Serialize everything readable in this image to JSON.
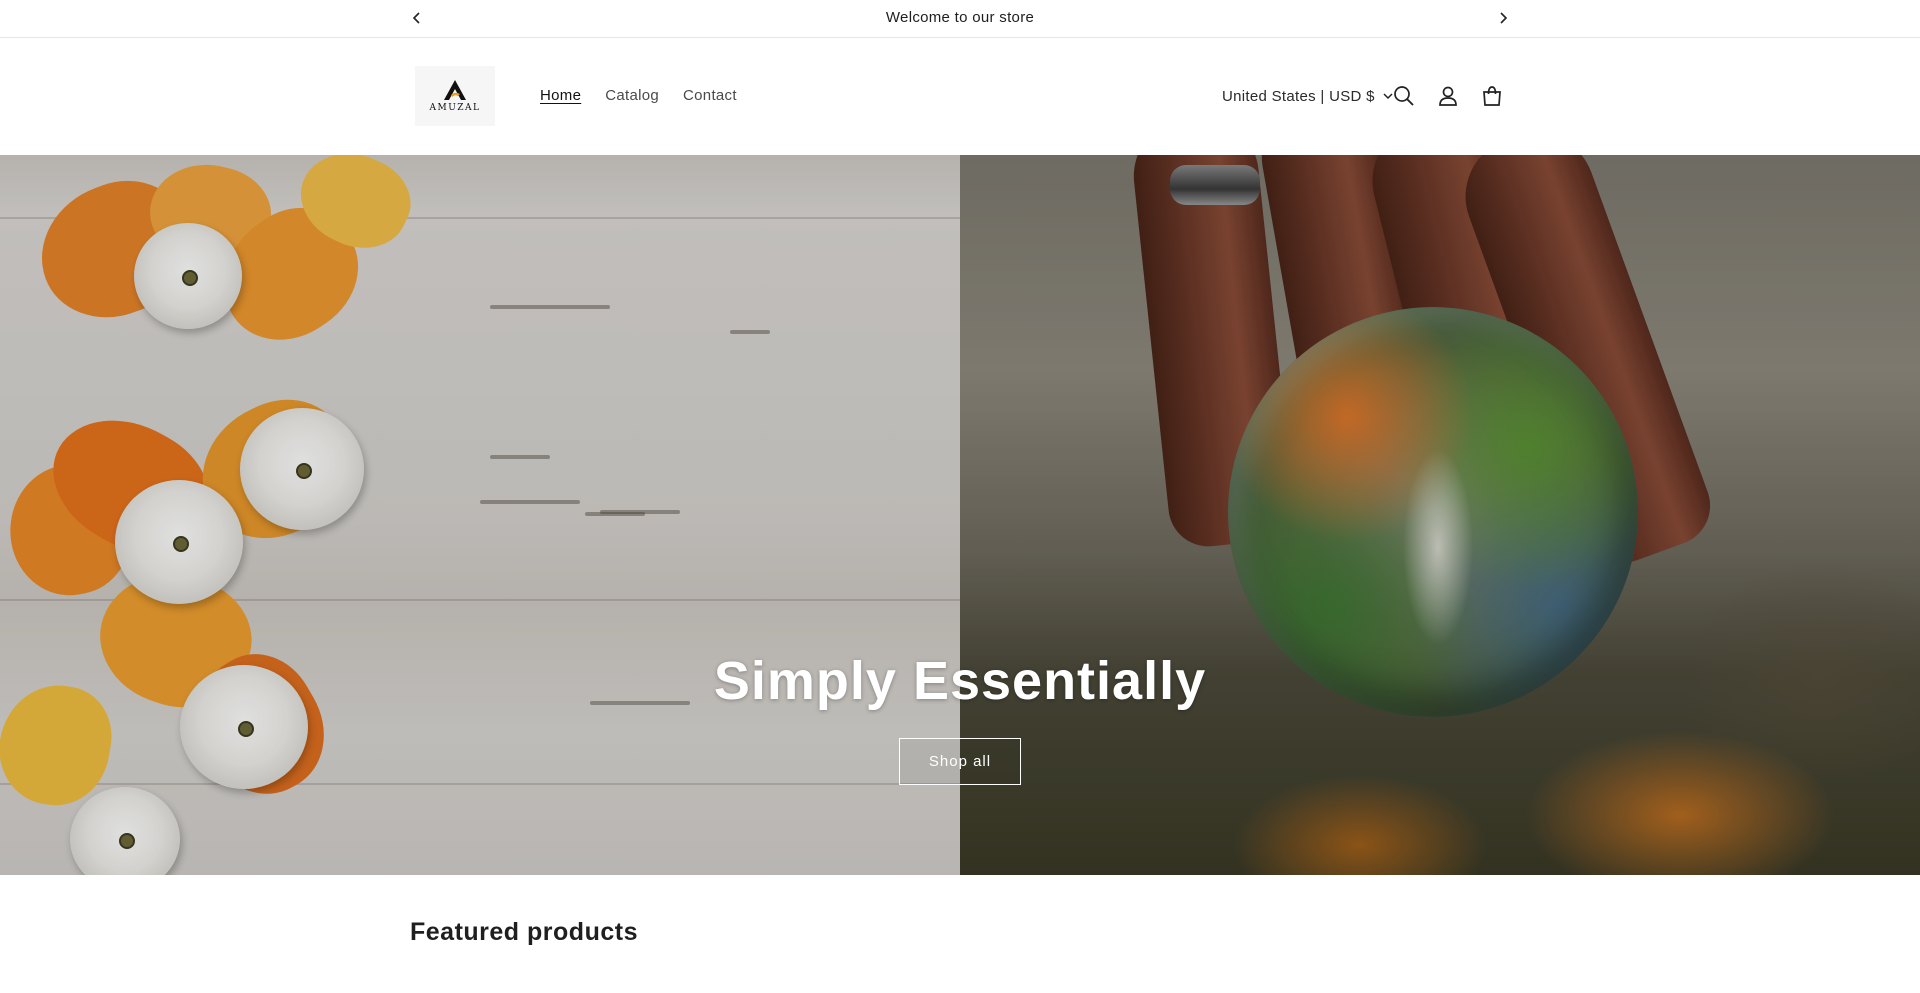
{
  "announcement": {
    "text": "Welcome to our store",
    "prev_icon": "chevron-left-icon",
    "next_icon": "chevron-right-icon"
  },
  "header": {
    "logo_text": "AMUZAL",
    "nav": [
      {
        "label": "Home",
        "active": true
      },
      {
        "label": "Catalog",
        "active": false
      },
      {
        "label": "Contact",
        "active": false
      }
    ],
    "country_selector": "United States | USD $",
    "icons": [
      "search-icon",
      "account-icon",
      "cart-icon"
    ]
  },
  "hero": {
    "title": "Simply Essentially",
    "button_label": "Shop all"
  },
  "featured": {
    "heading": "Featured products"
  },
  "colors": {
    "text": "#121212",
    "announce_border": "#e6e6e6",
    "hero_text": "#ffffff"
  }
}
